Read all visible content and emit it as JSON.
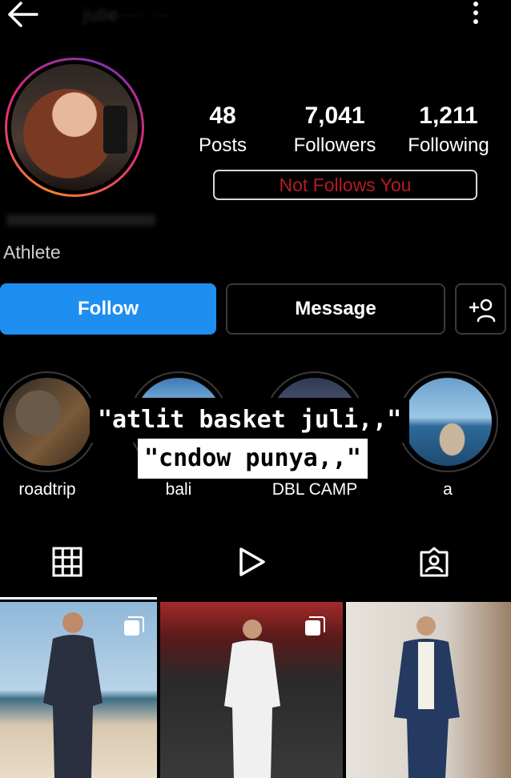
{
  "header": {
    "username": "julie···· ···"
  },
  "profile": {
    "stats": {
      "posts_value": "48",
      "posts_label": "Posts",
      "followers_value": "7,041",
      "followers_label": "Followers",
      "following_value": "1,211",
      "following_label": "Following"
    },
    "follow_status": "Not Follows You",
    "bio": "Athlete"
  },
  "actions": {
    "follow_label": "Follow",
    "message_label": "Message"
  },
  "highlights": [
    {
      "label": "roadtrip"
    },
    {
      "label": "bali"
    },
    {
      "label": "DBL CAMP"
    },
    {
      "label": "a"
    }
  ],
  "overlay": {
    "line1": "\"atlit basket juli,,\"",
    "line2": "\"cndow punya,,\""
  },
  "tabs": {
    "grid": "grid-icon",
    "reels": "reels-play-icon",
    "tagged": "tagged-person-icon"
  },
  "colors": {
    "follow_button": "#1e8ef0",
    "not_follows_text": "#b41c26",
    "background": "#000000"
  }
}
